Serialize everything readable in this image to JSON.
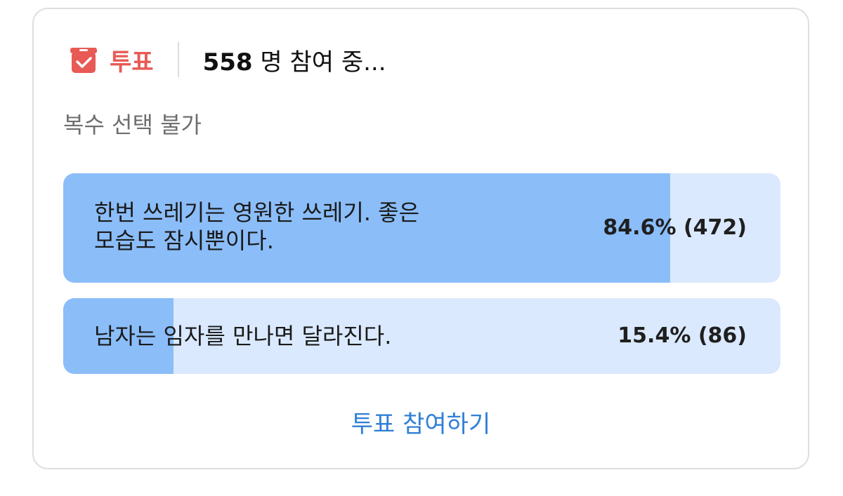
{
  "poll": {
    "label": "투표",
    "participants_count": "558",
    "participants_suffix": "명 참여 중...",
    "rule": "복수 선택 불가",
    "options": [
      {
        "text": "한번 쓰레기는 영원한 쓰레기. 좋은\n모습도 잠시뿐이다.",
        "result": "84.6% (472)",
        "percent": 84.6
      },
      {
        "text": "남자는 임자를 만나면 달라진다.",
        "result": "15.4% (86)",
        "percent": 15.4
      }
    ],
    "cta_label": "투표 참여하기"
  },
  "colors": {
    "accent_red": "#e85a55",
    "bar_fill": "#8bbdf9",
    "bar_track": "#dae9fd",
    "link_blue": "#2f7fd6"
  },
  "icons": {
    "poll": "ballot-box-check-icon"
  }
}
